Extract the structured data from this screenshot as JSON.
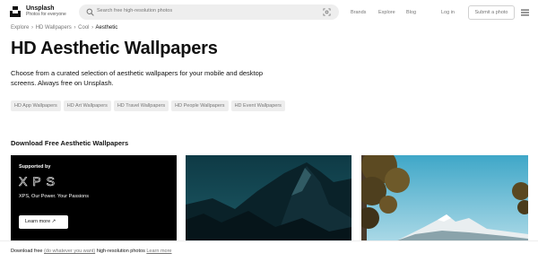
{
  "header": {
    "brand_name": "Unsplash",
    "brand_tagline": "Photos for everyone",
    "search_placeholder": "Search free high-resolution photos",
    "nav": [
      "Brands",
      "Explore",
      "Blog"
    ],
    "login_label": "Log in",
    "submit_label": "Submit a photo"
  },
  "breadcrumb": {
    "items": [
      "Explore",
      "HD Wallpapers",
      "Cool"
    ],
    "current": "Aesthetic",
    "separator": "›"
  },
  "page": {
    "title": "HD Aesthetic Wallpapers",
    "description": "Choose from a curated selection of aesthetic wallpapers for your mobile and desktop screens. Always free on Unsplash."
  },
  "tags": [
    "HD App Wallpapers",
    "HD Art Wallpapers",
    "HD Travel Wallpapers",
    "HD People Wallpapers",
    "HD Event Wallpapers"
  ],
  "section": {
    "title": "Download Free Aesthetic Wallpapers"
  },
  "ad": {
    "supported_by": "Supported by",
    "logo_text": "XPS",
    "tagline": "XPS, Our Power. Your Passions",
    "cta_label": "Learn more ↗"
  },
  "footer": {
    "prefix": "Download free",
    "link_text": "(do whatever you want)",
    "suffix": "high-resolution photos",
    "learn_more": "Learn more"
  },
  "colors": {
    "accent_text": "#111111",
    "muted_text": "#767676",
    "chip_bg": "#eeeeee",
    "ad_bg": "#000000"
  }
}
